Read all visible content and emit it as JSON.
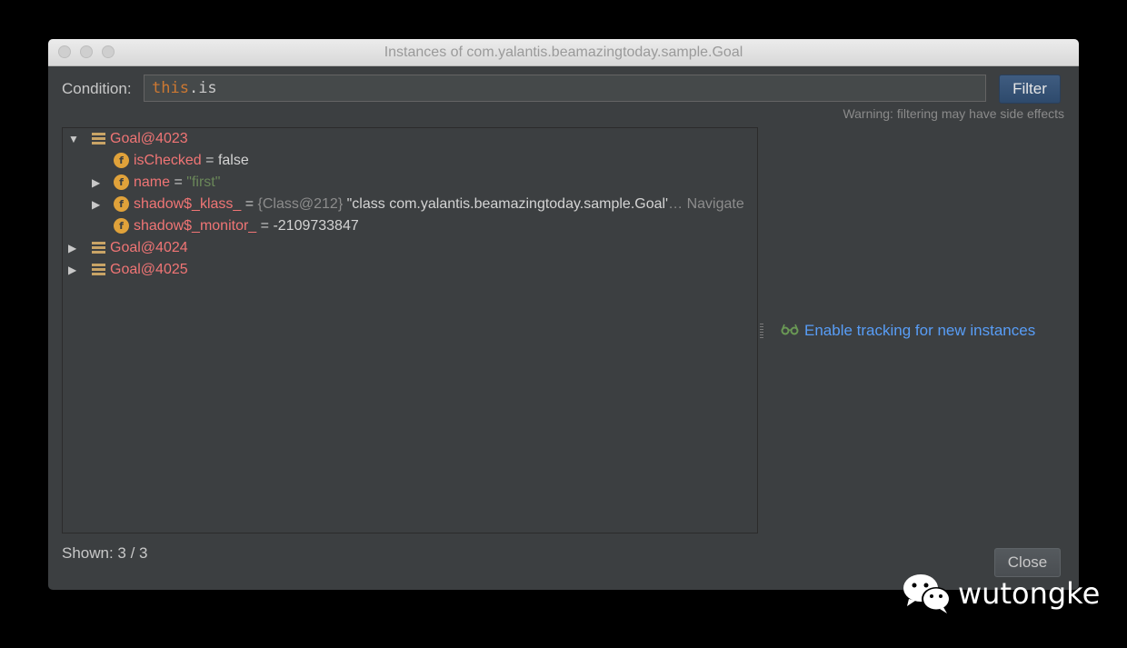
{
  "window": {
    "title": "Instances of com.yalantis.beamazingtoday.sample.Goal"
  },
  "condition": {
    "label": "Condition:",
    "keyword": "this",
    "rest": ".is"
  },
  "filter_button": "Filter",
  "warning": "Warning: filtering may have side effects",
  "tree": {
    "rows": [
      {
        "name": "Goal@4023",
        "expanded": true
      },
      {
        "field": "isChecked",
        "eq": " = ",
        "value": "false"
      },
      {
        "field": "name",
        "eq": " = ",
        "value": "\"first\""
      },
      {
        "field": "shadow$_klass_",
        "eq": " = ",
        "ref": "{Class@212}",
        "value": " \"class com.yalantis.beamazingtoday.sample.Goal'",
        "ellipsis": "… ",
        "link": "Navigate"
      },
      {
        "field": "shadow$_monitor_",
        "eq": " = ",
        "value": "-2109733847"
      },
      {
        "name": "Goal@4024",
        "expanded": false
      },
      {
        "name": "Goal@4025",
        "expanded": false
      }
    ]
  },
  "tracking_link": "Enable tracking for new instances",
  "shown": "Shown: 3 / 3",
  "close_button": "Close",
  "watermark": "wutongke",
  "colors": {
    "accent": "#589df6",
    "field_name": "#f07575",
    "string": "#6a8759",
    "background": "#3c3f41"
  }
}
